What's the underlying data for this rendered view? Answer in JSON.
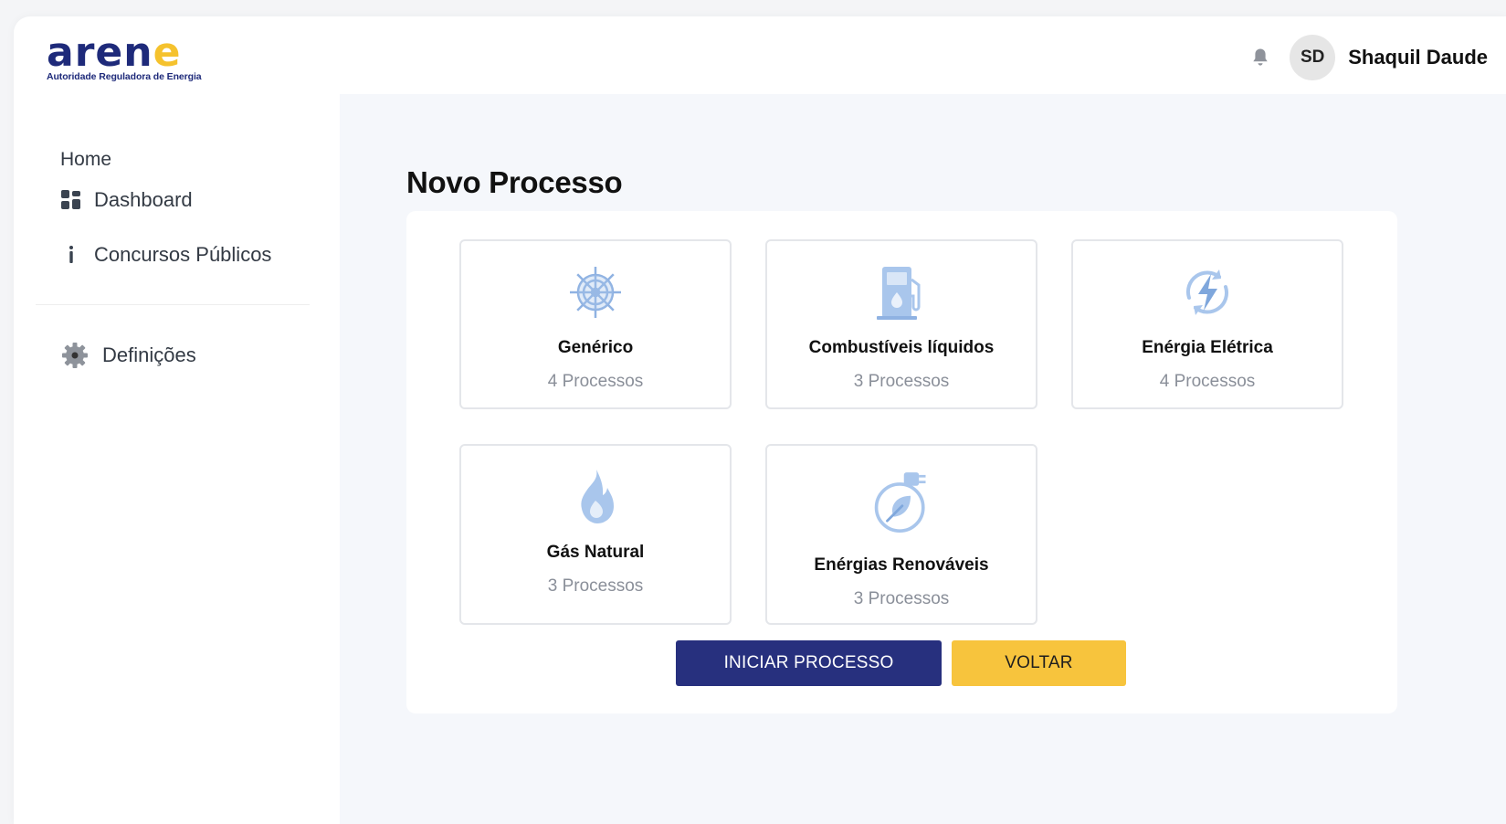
{
  "brand": {
    "logo_text_main": "aren",
    "logo_text_e": "e",
    "subtitle": "Autoridade Reguladora de Energia"
  },
  "header": {
    "avatar_initials": "SD",
    "user_name": "Shaquil Daude"
  },
  "sidebar": {
    "home_label": "Home",
    "items": [
      {
        "label": "Dashboard",
        "icon": "grid-icon"
      },
      {
        "label": "Concursos Públicos",
        "icon": "info-icon"
      },
      {
        "label": "Definições",
        "icon": "gear-icon"
      }
    ]
  },
  "main": {
    "title": "Novo Processo",
    "cards": [
      {
        "title": "Genérico",
        "count": "4 Processos",
        "icon": "wheel-icon"
      },
      {
        "title": "Combustíveis líquidos",
        "count": "3 Processos",
        "icon": "fuel-pump-icon"
      },
      {
        "title": "Enérgia Elétrica",
        "count": "4 Processos",
        "icon": "lightning-icon"
      },
      {
        "title": "Gás Natural",
        "count": "3 Processos",
        "icon": "flame-icon"
      },
      {
        "title": "Enérgias Renováveis",
        "count": "3 Processos",
        "icon": "leaf-plug-icon"
      }
    ],
    "primary_button": "INICIAR PROCESSO",
    "secondary_button": "VOLTAR"
  },
  "colors": {
    "brand_blue": "#27307e",
    "brand_yellow": "#f7c43d",
    "icon_blue": "#a9c6ec"
  }
}
